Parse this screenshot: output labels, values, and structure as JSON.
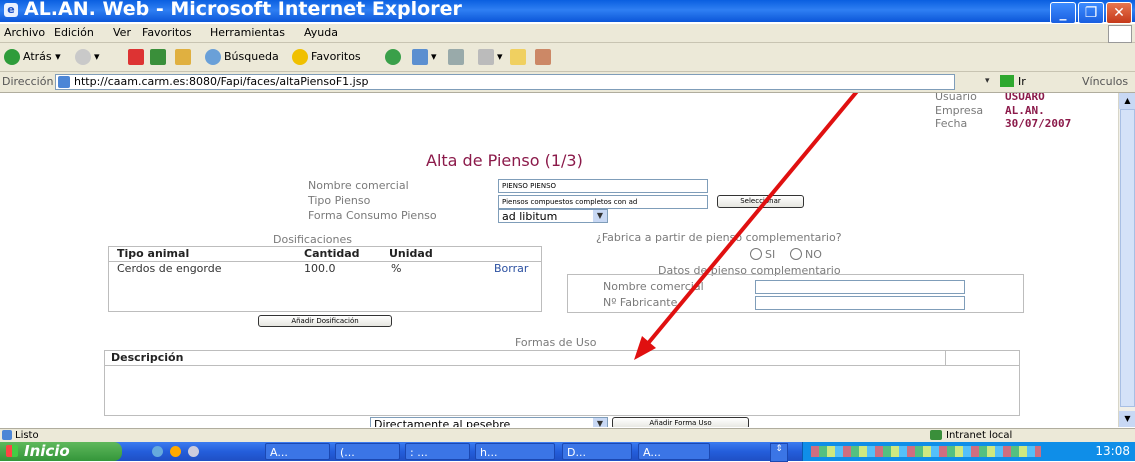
{
  "window": {
    "title": "AL.AN. Web - Microsoft Internet Explorer"
  },
  "menu": [
    "Archivo",
    "Edición",
    "Ver",
    "Favoritos",
    "Herramientas",
    "Ayuda"
  ],
  "toolbar": {
    "back": "Atrás",
    "search": "Búsqueda",
    "favorites": "Favoritos"
  },
  "address": {
    "label": "Dirección",
    "url": "http://caam.carm.es:8080/Fapi/faces/altaPiensoF1.jsp",
    "go": "Ir",
    "links": "Vínculos"
  },
  "user_info": {
    "user_label": "Usuario",
    "user_value": "USUARO",
    "company_label": "Empresa",
    "company_value": "AL.AN.",
    "date_label": "Fecha",
    "date_value": "30/07/2007"
  },
  "form": {
    "title": "Alta de Pienso (1/3)",
    "nombre_label": "Nombre comercial",
    "nombre_value": "PIENSO PIENSO",
    "tipo_label": "Tipo Pienso",
    "tipo_value": "Piensos compuestos  completos con ad",
    "seleccionar": "Seleccionar",
    "forma_label": "Forma Consumo Pienso",
    "forma_value": "ad libitum"
  },
  "dosificaciones": {
    "title": "Dosificaciones",
    "headers": [
      "Tipo animal",
      "Cantidad",
      "Unidad"
    ],
    "rows": [
      {
        "tipo": "Cerdos de engorde",
        "cantidad": "100.0",
        "unidad": "%",
        "action": "Borrar"
      }
    ],
    "add_button": "Añadir Dosificación"
  },
  "complementario": {
    "question": "¿Fabrica a partir de pienso complementario?",
    "si": "SI",
    "no": "NO",
    "datos_title": "Datos de pienso complementario",
    "nombre_label": "Nombre comercial",
    "fabricante_label": "Nº Fabricante"
  },
  "formas_uso": {
    "title": "Formas de Uso",
    "header": "Descripción",
    "select_value": "Directamente al pesebre",
    "add_button": "Añadir Forma Uso"
  },
  "status": {
    "left": "Listo",
    "zone": "Intranet local"
  },
  "taskbar": {
    "start": "Inicio",
    "items": [
      "A...",
      "(...",
      ": ...",
      "h...",
      "D...",
      "A..."
    ],
    "clock": "13:08"
  },
  "colors": {
    "title_accent": "#8b1a4a",
    "value_accent": "#8b1a4a",
    "annotation_arrow": "#e01010"
  }
}
